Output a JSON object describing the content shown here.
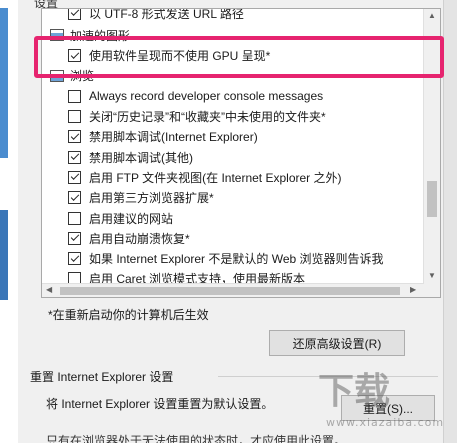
{
  "header_label": "设置",
  "settings_rows": [
    {
      "kind": "checkbox",
      "checked": true,
      "label": "以 UTF-8 形式发送 URL 路径"
    },
    {
      "kind": "category",
      "label": "加速的图形"
    },
    {
      "kind": "checkbox",
      "checked": true,
      "label": "使用软件呈现而不使用 GPU 呈现*"
    },
    {
      "kind": "category",
      "label": "浏览"
    },
    {
      "kind": "checkbox",
      "checked": false,
      "label": "Always record developer console messages"
    },
    {
      "kind": "checkbox",
      "checked": false,
      "label": "关闭“历史记录”和“收藏夹”中未使用的文件夹*"
    },
    {
      "kind": "checkbox",
      "checked": true,
      "label": "禁用脚本调试(Internet Explorer)"
    },
    {
      "kind": "checkbox",
      "checked": true,
      "label": "禁用脚本调试(其他)"
    },
    {
      "kind": "checkbox",
      "checked": true,
      "label": "启用 FTP 文件夹视图(在 Internet Explorer 之外)"
    },
    {
      "kind": "checkbox",
      "checked": true,
      "label": "启用第三方浏览器扩展*"
    },
    {
      "kind": "checkbox",
      "checked": false,
      "label": "启用建议的网站"
    },
    {
      "kind": "checkbox",
      "checked": true,
      "label": "启用自动崩溃恢复*"
    },
    {
      "kind": "checkbox",
      "checked": true,
      "label": "如果 Internet Explorer 不是默认的 Web 浏览器则告诉我"
    },
    {
      "kind": "checkbox",
      "checked": false,
      "label": "启用 Caret 浏览模式支持，使用最新版本"
    }
  ],
  "restart_note": "*在重新启动你的计算机后生效",
  "restore_button": "还原高级设置(R)",
  "reset_group_title": "重置 Internet Explorer 设置",
  "reset_desc": "将 Internet Explorer 设置重置为默认设置。",
  "reset_button": "重置(S)...",
  "bottom_text": "只有在浏览器处于无法使用的状态时，才应使用此设置。",
  "watermark": "下载",
  "watermark_sub": "www.xiazaiba.com",
  "highlight_color": "#e6246f"
}
